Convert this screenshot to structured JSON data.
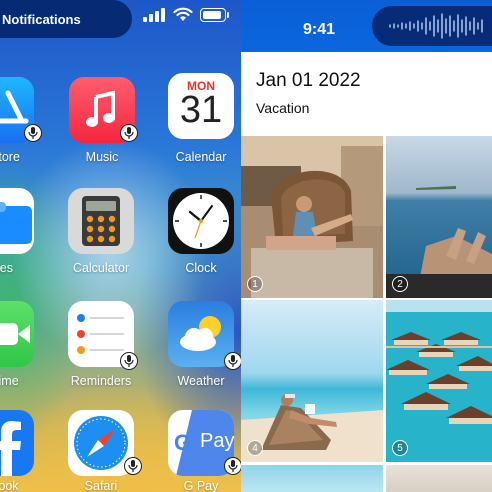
{
  "left": {
    "notification_pill": "Notifications",
    "apps": [
      {
        "label": "Store",
        "icon": "app-store-icon"
      },
      {
        "label": "Music",
        "icon": "music-icon"
      },
      {
        "label": "Calendar",
        "icon": "calendar-icon",
        "month": "MON",
        "day": "31"
      },
      {
        "label": "les",
        "icon": "files-icon"
      },
      {
        "label": "Calculator",
        "icon": "calculator-icon"
      },
      {
        "label": "Clock",
        "icon": "clock-icon"
      },
      {
        "label": "Time",
        "icon": "facetime-icon"
      },
      {
        "label": "Reminders",
        "icon": "reminders-icon"
      },
      {
        "label": "Weather",
        "icon": "weather-icon"
      },
      {
        "label": "book",
        "icon": "facebook-icon"
      },
      {
        "label": "Safari",
        "icon": "safari-icon"
      },
      {
        "label": "G Pay",
        "icon": "google-pay-icon",
        "pay_text": "Pay"
      }
    ]
  },
  "right": {
    "status_time": "9:41",
    "album_date": "Jan 01 2022",
    "album_name": "Vacation",
    "photos": [
      {
        "number": "1",
        "subject": "woman in rattan chair on terrace"
      },
      {
        "number": "2",
        "subject": "feet over ocean"
      },
      {
        "number": "4",
        "subject": "person on beach lounger"
      },
      {
        "number": "5",
        "subject": "overwater villas"
      }
    ]
  },
  "colors": {
    "header_blue": "#0b62da",
    "island_navy": "#062c78",
    "calendar_red": "#e5352b"
  }
}
